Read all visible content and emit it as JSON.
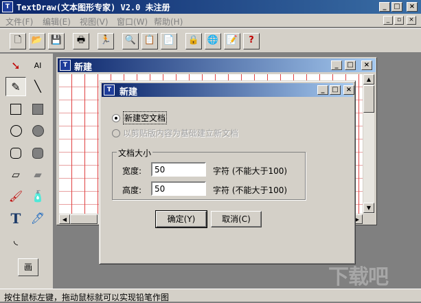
{
  "app": {
    "title": "TextDraw(文本图形专家) V2.0 未注册",
    "icon_text": "T"
  },
  "menu": {
    "items": [
      {
        "label": "文件(F)"
      },
      {
        "label": "编辑(E)"
      },
      {
        "label": "视图(V)"
      },
      {
        "label": "窗口(W)"
      },
      {
        "label": "帮助(H)"
      }
    ]
  },
  "toolbar": {
    "buttons": [
      {
        "name": "new-file",
        "glyph": "🗋"
      },
      {
        "name": "open-file",
        "glyph": "📂"
      },
      {
        "name": "save",
        "glyph": "💾"
      },
      {
        "name": "print",
        "glyph": "🖶"
      },
      {
        "name": "run",
        "glyph": "🏃"
      },
      {
        "name": "find",
        "glyph": "🔍"
      },
      {
        "name": "copy",
        "glyph": "📋"
      },
      {
        "name": "paste",
        "glyph": "📄"
      },
      {
        "name": "lock",
        "glyph": "🔒"
      },
      {
        "name": "web",
        "glyph": "🌐"
      },
      {
        "name": "properties",
        "glyph": "📝"
      },
      {
        "name": "help",
        "glyph": "?"
      }
    ]
  },
  "toolbox": {
    "text_tool_label": "AI",
    "draw_button_label": "画"
  },
  "child_window": {
    "title": "新建"
  },
  "dialog": {
    "title": "新建",
    "option_empty": "新建空文档",
    "option_clipboard": "以剪贴版内容为基础建立新文档",
    "group_title": "文档大小",
    "width_label": "宽度:",
    "width_value": "50",
    "width_hint": "字符 (不能大于100)",
    "height_label": "高度:",
    "height_value": "50",
    "height_hint": "字符 (不能大于100)",
    "ok_label": "确定(Y)",
    "cancel_label": "取消(C)"
  },
  "status": {
    "text": "按住鼠标左键，拖动鼠标就可以实现铅笔作图"
  },
  "watermark": {
    "text": "下载吧"
  }
}
